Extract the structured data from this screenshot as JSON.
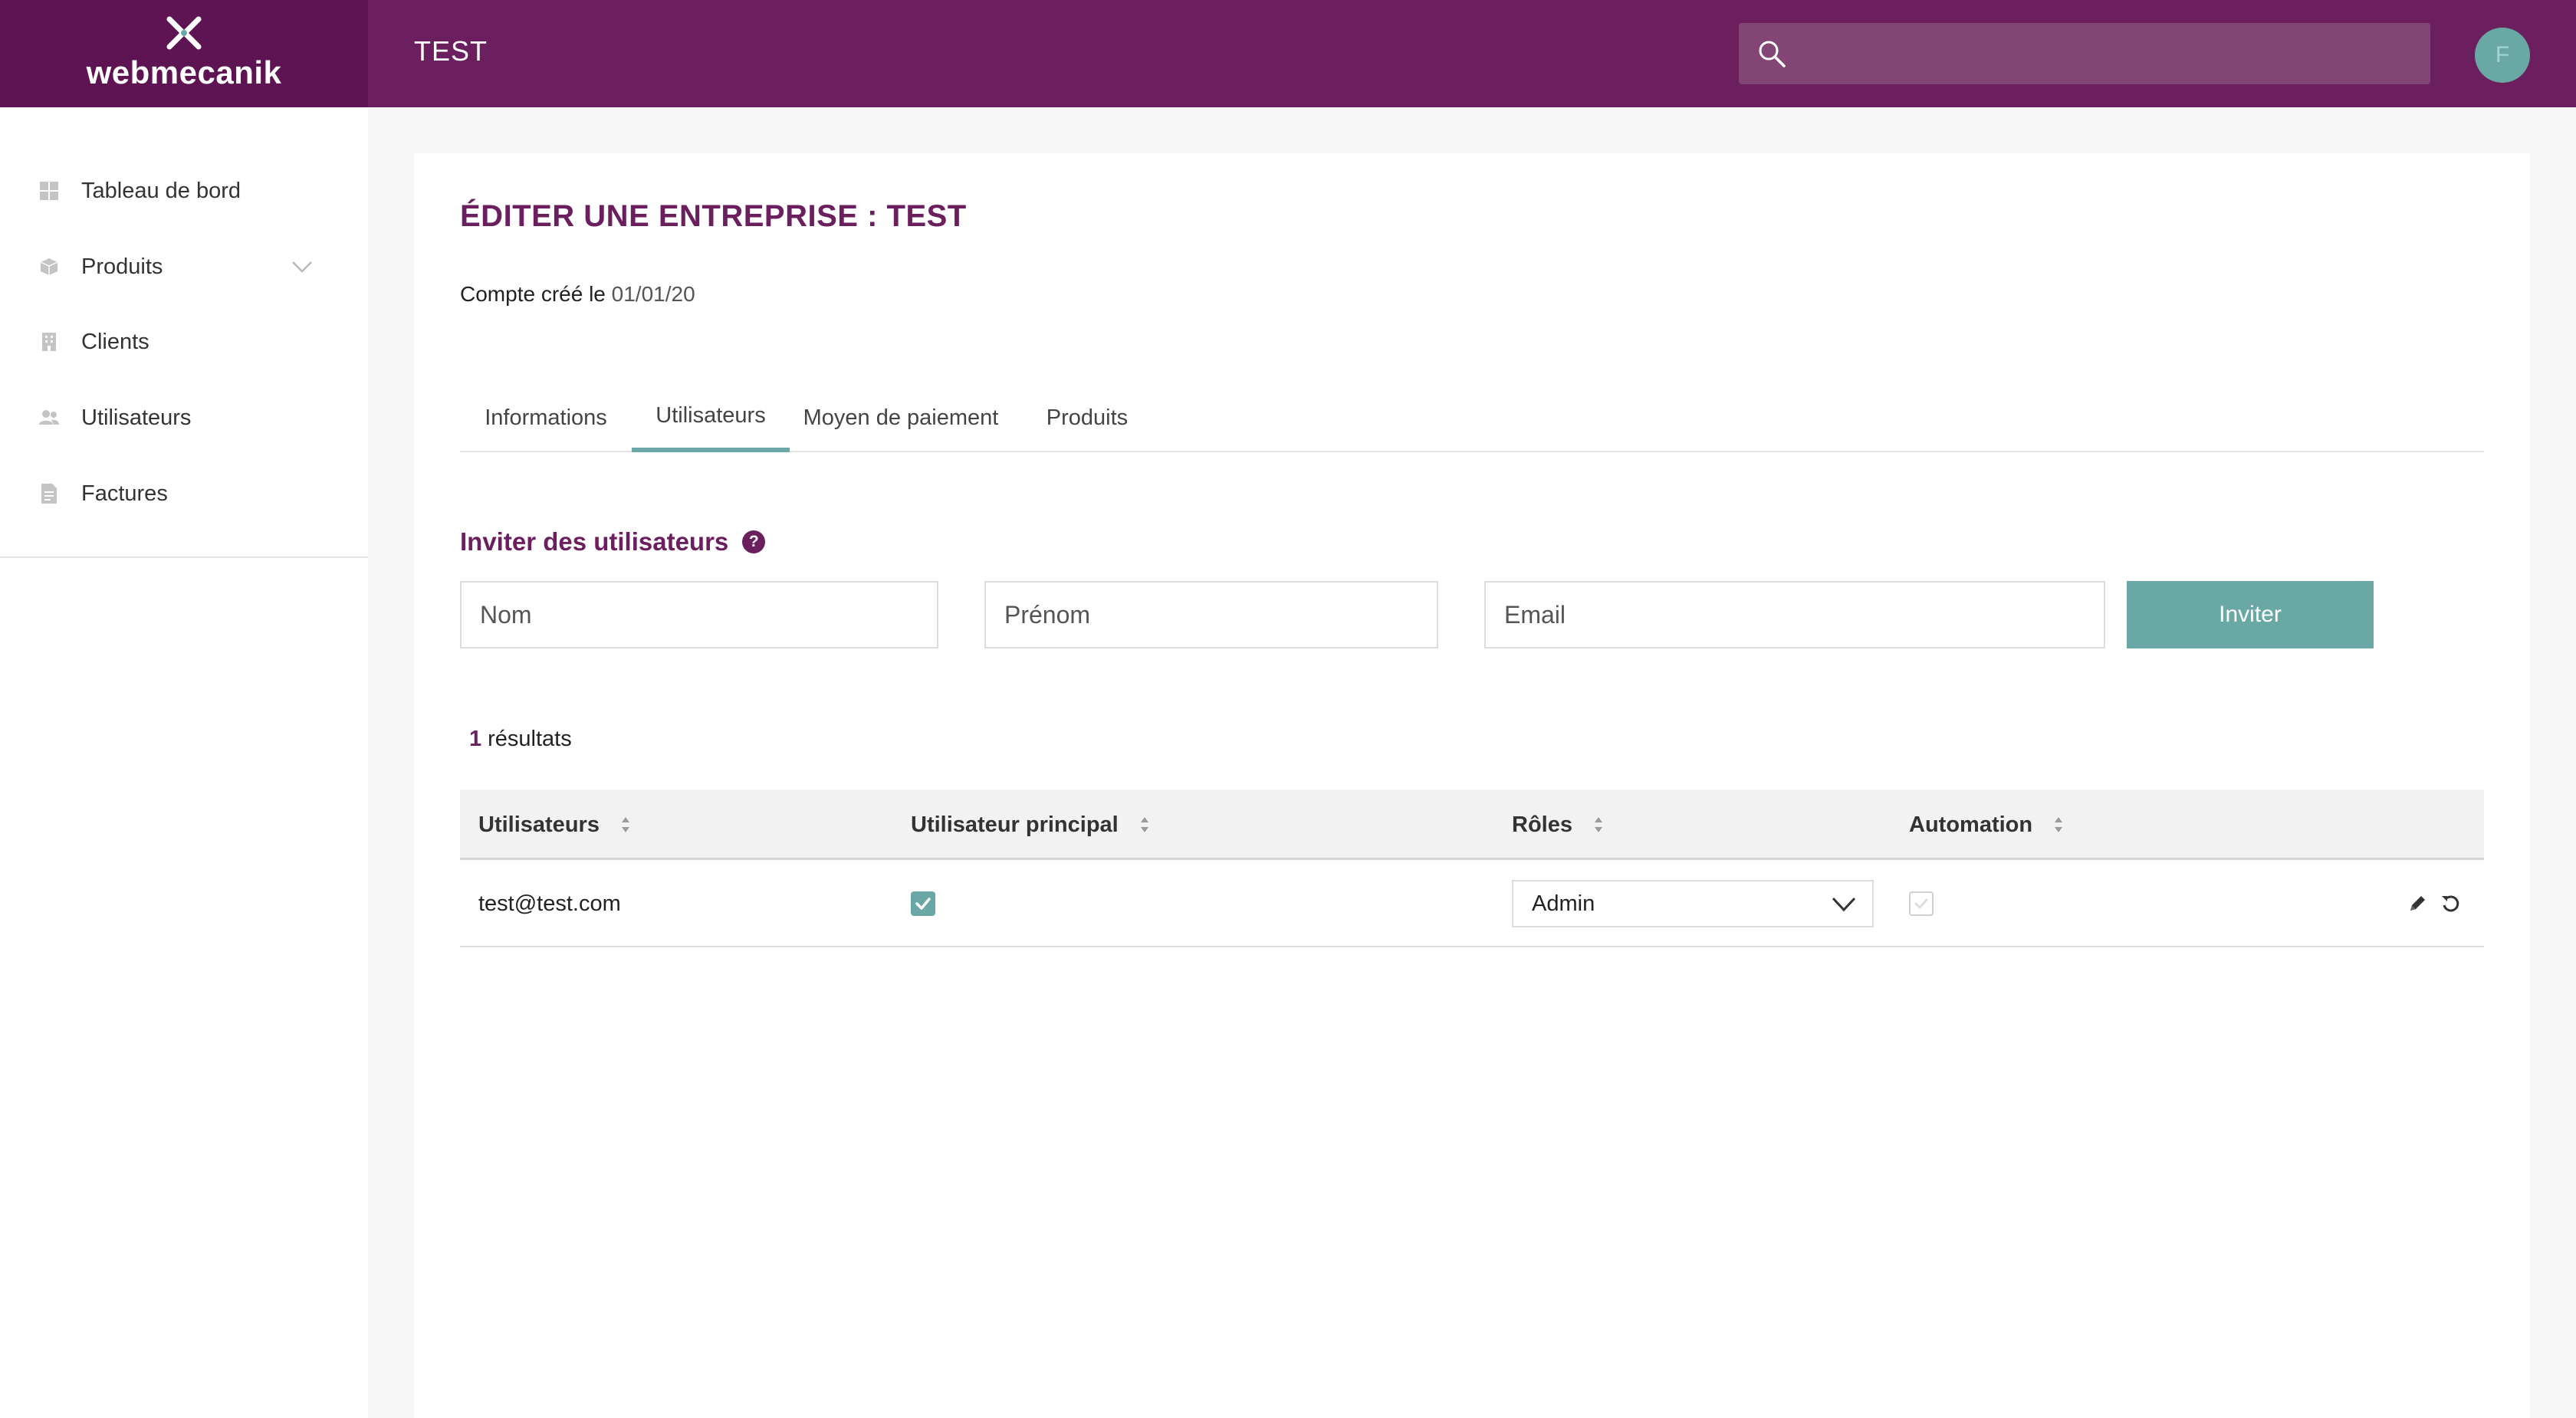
{
  "header": {
    "logo_text": "webmecanik",
    "title": "TEST",
    "search_placeholder": "",
    "avatar_initial": "F"
  },
  "sidebar": {
    "items": [
      {
        "label": "Tableau de bord",
        "icon": "dashboard-icon"
      },
      {
        "label": "Produits",
        "icon": "box-icon",
        "expandable": true
      },
      {
        "label": "Clients",
        "icon": "building-icon"
      },
      {
        "label": "Utilisateurs",
        "icon": "users-icon"
      },
      {
        "label": "Factures",
        "icon": "document-icon"
      }
    ]
  },
  "page": {
    "title": "ÉDITER UNE ENTREPRISE : TEST",
    "created_label": "Compte créé le",
    "created_date": "01/01/20",
    "tabs": [
      {
        "label": "Informations",
        "active": false
      },
      {
        "label": "Utilisateurs",
        "active": true
      },
      {
        "label": "Moyen de paiement",
        "active": false
      },
      {
        "label": "Produits",
        "active": false
      }
    ]
  },
  "invite": {
    "title": "Inviter des utilisateurs",
    "help_glyph": "?",
    "fields": {
      "nom_placeholder": "Nom",
      "prenom_placeholder": "Prénom",
      "email_placeholder": "Email"
    },
    "button_label": "Inviter"
  },
  "results": {
    "count": "1",
    "label": "résultats"
  },
  "table": {
    "headers": [
      "Utilisateurs",
      "Utilisateur principal",
      "Rôles",
      "Automation"
    ],
    "rows": [
      {
        "user": "test@test.com",
        "principal": true,
        "role": "Admin",
        "automation": false
      }
    ]
  },
  "colors": {
    "brand": "#6b1f5e",
    "logo_bg": "#5e1352",
    "accent": "#6aa8a6"
  }
}
